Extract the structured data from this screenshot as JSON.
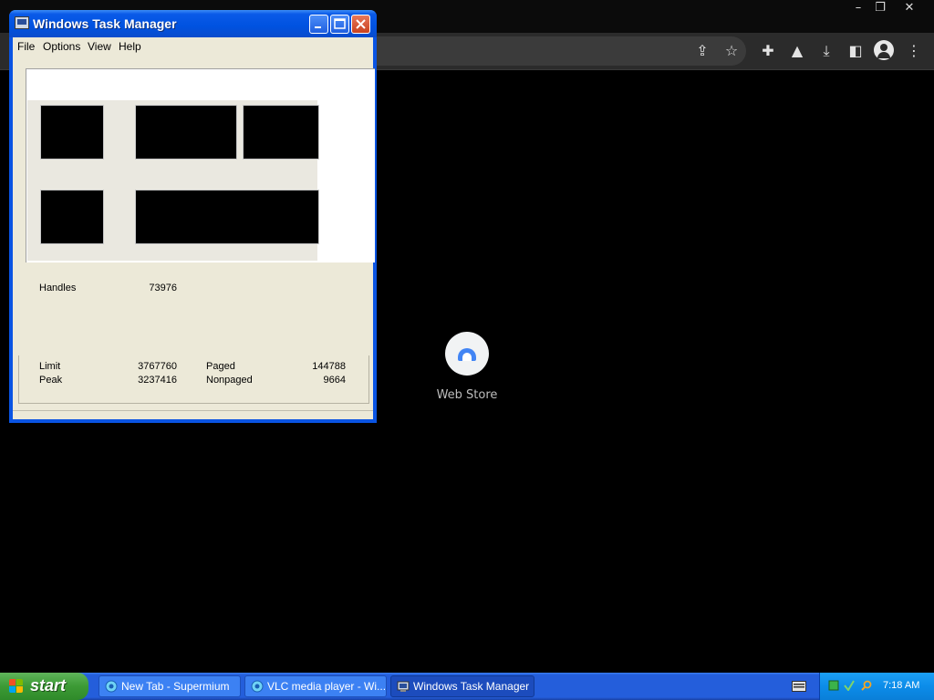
{
  "browser": {
    "window_controls": {
      "minimize": "–",
      "restore": "❐",
      "close": "✕"
    },
    "shortcut": {
      "label": "Web Store"
    }
  },
  "task_manager": {
    "title": "Windows Task Manager",
    "menu": [
      "File",
      "Options",
      "View",
      "Help"
    ],
    "handles": {
      "label": "Handles",
      "value": "73976"
    },
    "commit": {
      "limit_label": "Limit",
      "limit_value": "3767760",
      "peak_label": "Peak",
      "peak_value": "3237416"
    },
    "kernel": {
      "paged_label": "Paged",
      "paged_value": "144788",
      "nonpaged_label": "Nonpaged",
      "nonpaged_value": "9664"
    }
  },
  "taskbar": {
    "start_label": "start",
    "tasks": [
      {
        "label": "New Tab - Supermium"
      },
      {
        "label": "VLC media player - Wi..."
      },
      {
        "label": "Windows Task Manager"
      }
    ],
    "clock": "7:18 AM"
  },
  "colors": {
    "xp_blue": "#245edb",
    "start_green": "#3c9a35",
    "tray_blue": "#0c8ce9"
  }
}
